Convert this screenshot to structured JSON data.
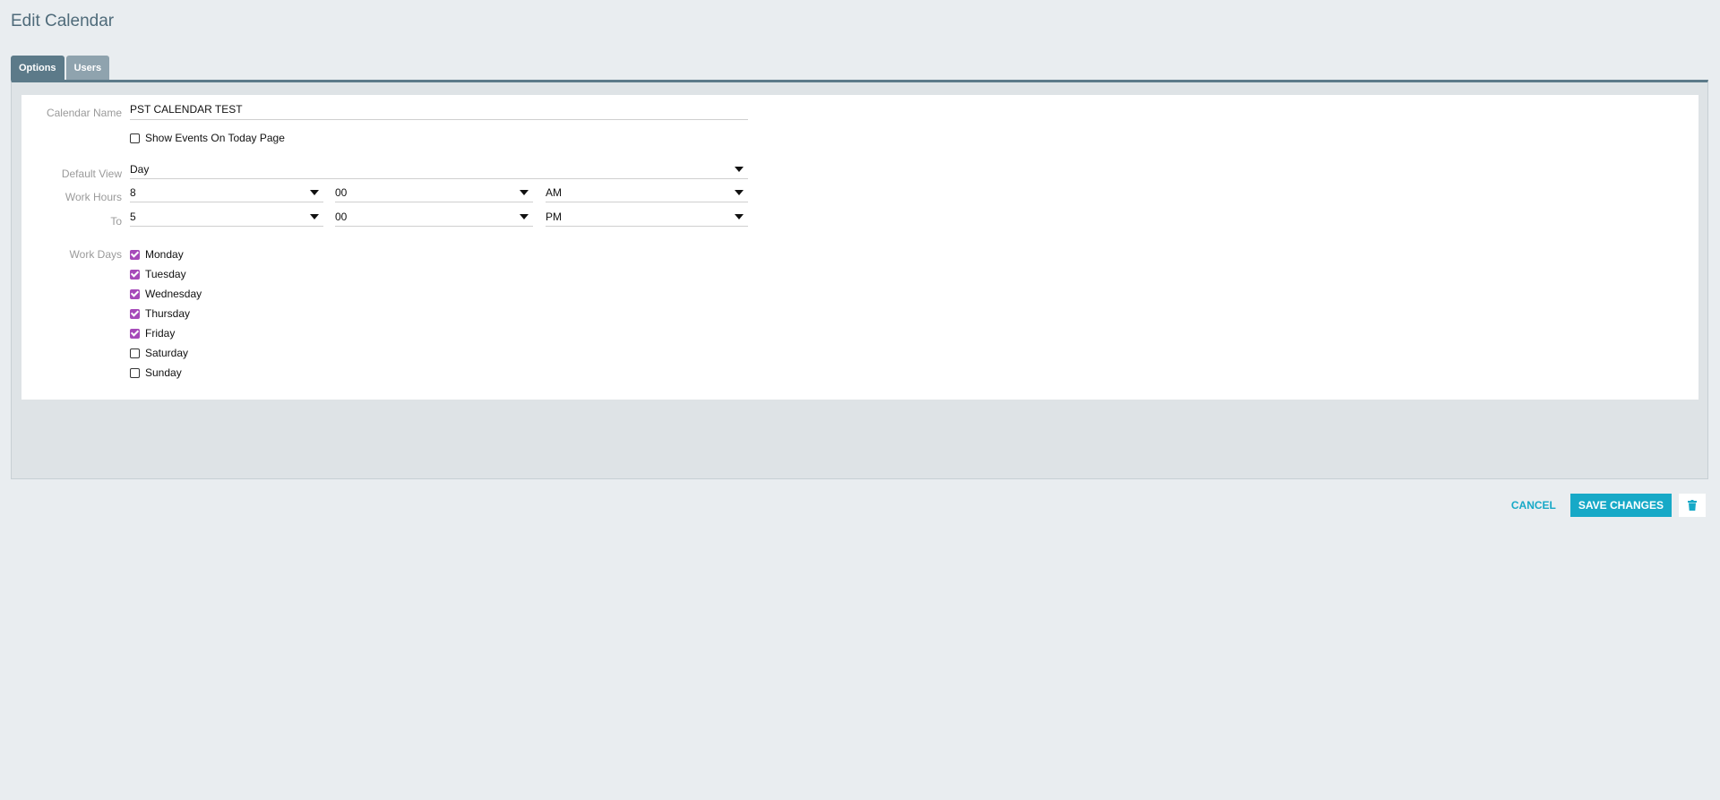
{
  "page": {
    "title": "Edit Calendar"
  },
  "tabs": [
    {
      "label": "Options",
      "active": true
    },
    {
      "label": "Users",
      "active": false
    }
  ],
  "form": {
    "calendar_name_label": "Calendar Name",
    "calendar_name_value": "PST CALENDAR TEST",
    "show_events_label": "Show Events On Today Page",
    "show_events_checked": false,
    "default_view_label": "Default View",
    "default_view_value": "Day",
    "work_hours_label": "Work Hours",
    "start_hour": "8",
    "start_minute": "00",
    "start_ampm": "AM",
    "to_label": "To",
    "end_hour": "5",
    "end_minute": "00",
    "end_ampm": "PM",
    "work_days_label": "Work Days",
    "days": [
      {
        "label": "Monday",
        "checked": true
      },
      {
        "label": "Tuesday",
        "checked": true
      },
      {
        "label": "Wednesday",
        "checked": true
      },
      {
        "label": "Thursday",
        "checked": true
      },
      {
        "label": "Friday",
        "checked": true
      },
      {
        "label": "Saturday",
        "checked": false
      },
      {
        "label": "Sunday",
        "checked": false
      }
    ]
  },
  "actions": {
    "cancel_label": "CANCEL",
    "save_label": "SAVE CHANGES",
    "delete_icon": "trash-icon"
  },
  "colors": {
    "accent": "#17a9c7",
    "checkbox": "#a64ab9",
    "tab_active": "#5c7a89"
  }
}
